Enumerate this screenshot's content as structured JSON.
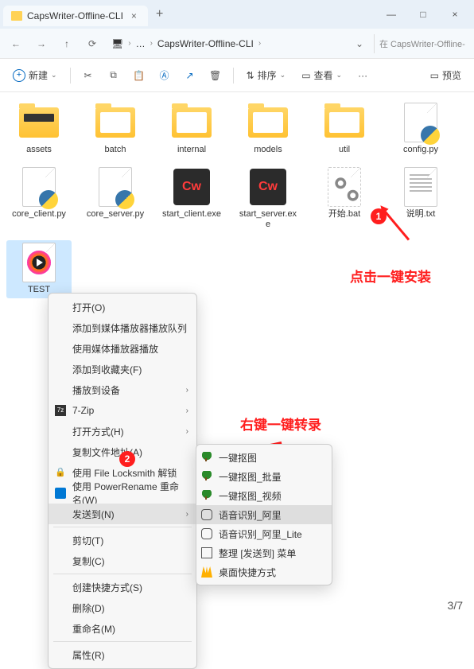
{
  "window": {
    "tab_title": "CapsWriter-Offline-CLI",
    "win_min": "—",
    "win_max": "□",
    "win_close": "×"
  },
  "nav": {
    "back": "←",
    "forward": "→",
    "up": "↑",
    "refresh": "⟳",
    "breadcrumb_more": "…",
    "breadcrumb_current": "CapsWriter-Offline-CLI",
    "search_placeholder": "在 CapsWriter-Offline-"
  },
  "toolbar": {
    "new_label": "新建",
    "sort_label": "排序",
    "view_label": "查看",
    "more": "···",
    "preview_label": "预览"
  },
  "files": [
    {
      "name": "assets",
      "kind": "folder-dark"
    },
    {
      "name": "batch",
      "kind": "folder-doc"
    },
    {
      "name": "internal",
      "kind": "folder-doc"
    },
    {
      "name": "models",
      "kind": "folder-doc"
    },
    {
      "name": "util",
      "kind": "folder-doc"
    },
    {
      "name": "config.py",
      "kind": "py"
    },
    {
      "name": "core_client.py",
      "kind": "py"
    },
    {
      "name": "core_server.py",
      "kind": "py"
    },
    {
      "name": "start_client.exe",
      "kind": "cw"
    },
    {
      "name": "start_server.exe",
      "kind": "cw"
    },
    {
      "name": "开始.bat",
      "kind": "bat"
    },
    {
      "name": "说明.txt",
      "kind": "txt"
    },
    {
      "name": "TEST",
      "kind": "media",
      "selected": true
    }
  ],
  "annotations": {
    "badge1": "1",
    "badge2": "2",
    "text1": "点击一键安装",
    "text2": "右键一键转录"
  },
  "context_menu": [
    {
      "label": "打开(O)"
    },
    {
      "label": "添加到媒体播放器播放队列"
    },
    {
      "label": "使用媒体播放器播放"
    },
    {
      "label": "添加到收藏夹(F)"
    },
    {
      "label": "播放到设备",
      "submenu": true
    },
    {
      "label": "7-Zip",
      "submenu": true,
      "icon": "7z"
    },
    {
      "label": "打开方式(H)",
      "submenu": true
    },
    {
      "label": "复制文件地址(A)"
    },
    {
      "label": "使用 File Locksmith 解锁",
      "icon": "lock"
    },
    {
      "label": "使用 PowerRename 重命名(W)",
      "icon": "rename"
    },
    {
      "label": "发送到(N)",
      "submenu": true,
      "highlighted": true
    },
    {
      "sep": true
    },
    {
      "label": "剪切(T)"
    },
    {
      "label": "复制(C)"
    },
    {
      "sep": true
    },
    {
      "label": "创建快捷方式(S)"
    },
    {
      "label": "删除(D)"
    },
    {
      "label": "重命名(M)"
    },
    {
      "sep": true
    },
    {
      "label": "属性(R)"
    }
  ],
  "submenu": [
    {
      "label": "一键抠图",
      "icon": "tree"
    },
    {
      "label": "一键抠图_批量",
      "icon": "tree"
    },
    {
      "label": "一键抠图_视频",
      "icon": "tree"
    },
    {
      "label": "语音识别_阿里",
      "icon": "mic",
      "highlighted": true
    },
    {
      "label": "语音识别_阿里_Lite",
      "icon": "mic"
    },
    {
      "label": "整理 [发送到] 菜单",
      "icon": "grid"
    },
    {
      "label": "桌面快捷方式",
      "icon": "crown"
    }
  ],
  "footer": {
    "page_counter": "3/7"
  }
}
